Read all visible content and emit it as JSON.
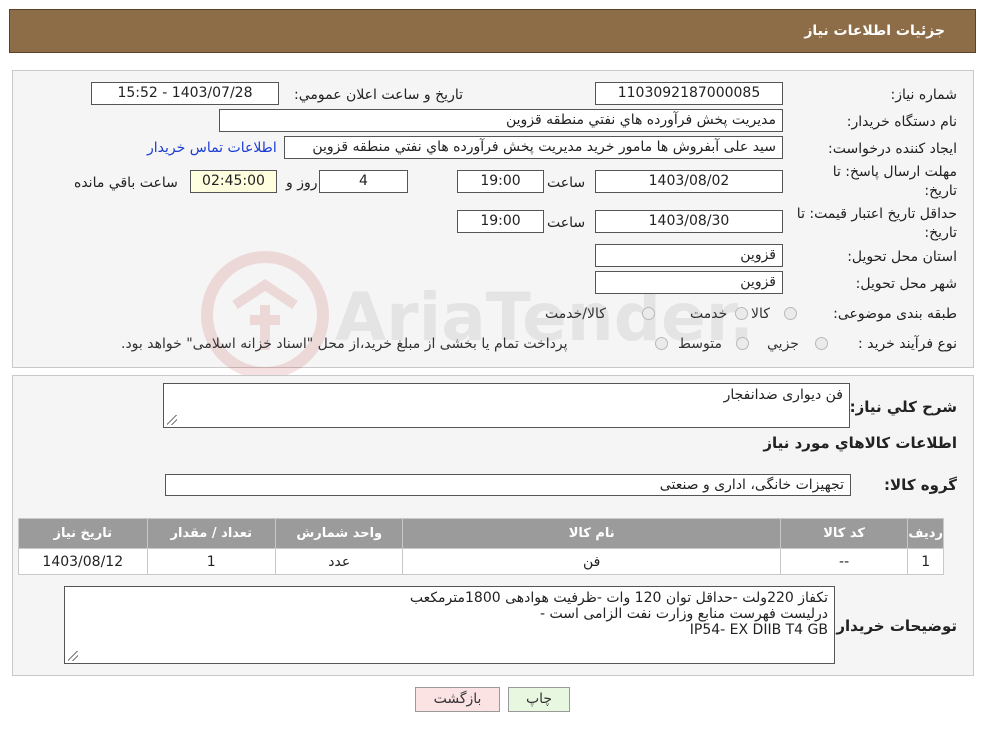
{
  "header": {
    "title": "جزئيات اطلاعات نياز"
  },
  "form": {
    "need_number_label": "شماره نياز:",
    "need_number": "1103092187000085",
    "announce_label": "تاريخ و ساعت اعلان عمومي:",
    "announce_value": "1403/07/28 - 15:52",
    "buyer_org_label": "نام دستگاه خريدار:",
    "buyer_org": "مديريت پخش فرآورده هاي نفتي منطقه قزوين",
    "creator_label": "ايجاد کننده درخواست:",
    "creator": "سيد علی  آبفروش ها مامور خريد مديريت پخش فرآورده هاي نفتي منطقه قزوين",
    "contact_link": "اطلاعات تماس خريدار",
    "deadline_label_1": "مهلت ارسال پاسخ: تا",
    "deadline_label_2": "تاريخ:",
    "deadline_date": "1403/08/02",
    "time_label": "ساعت",
    "deadline_time": "19:00",
    "days_value": "4",
    "days_label": "روز و",
    "remaining_time": "02:45:00",
    "remaining_label": "ساعت باقي مانده",
    "validity_label_1": "حداقل تاريخ اعتبار قيمت: تا",
    "validity_label_2": "تاريخ:",
    "validity_date": "1403/08/30",
    "validity_time": "19:00",
    "province_label": "استان محل تحويل:",
    "province": "قزوين",
    "city_label": "شهر محل تحويل:",
    "city": "قزوين",
    "category_label": "طبقه بندی موضوعی:",
    "category_options": [
      "کالا",
      "خدمت",
      "کالا/خدمت"
    ],
    "purchase_type_label": "نوع فرآيند خريد :",
    "purchase_options": [
      "جزيي",
      "متوسط"
    ],
    "purchase_note": "پرداخت تمام يا بخشی از مبلغ خريد،از محل \"اسناد خزانه اسلامی\" خواهد بود."
  },
  "details": {
    "summary_label": "شرح کلي نياز:",
    "summary": "فن ديواری ضدانفجار",
    "goods_info_title": "اطلاعات کالاهاي مورد نياز",
    "group_label": "گروه کالا:",
    "group": "تجهيزات خانگی، اداری و صنعتی",
    "table": {
      "headers": [
        "رديف",
        "کد کالا",
        "نام کالا",
        "واحد شمارش",
        "تعداد / مقدار",
        "تاريخ نياز"
      ],
      "rows": [
        [
          "1",
          "--",
          "فن",
          "عدد",
          "1",
          "1403/08/12"
        ]
      ]
    },
    "buyer_notes_label": "توضيحات خريدار:",
    "buyer_notes_line1": "تکفاز 220ولت -حداقل توان 120 وات -ظرفيت هوادهی 1800مترمکعب",
    "buyer_notes_line2": "درليست فهرست منابع وزارت نفت الزامی است -",
    "buyer_notes_line3": "IP54- EX DIIB T4 GB"
  },
  "buttons": {
    "print": "چاپ",
    "back": "بازگشت"
  },
  "watermark_text": "AriaTender.neT"
}
